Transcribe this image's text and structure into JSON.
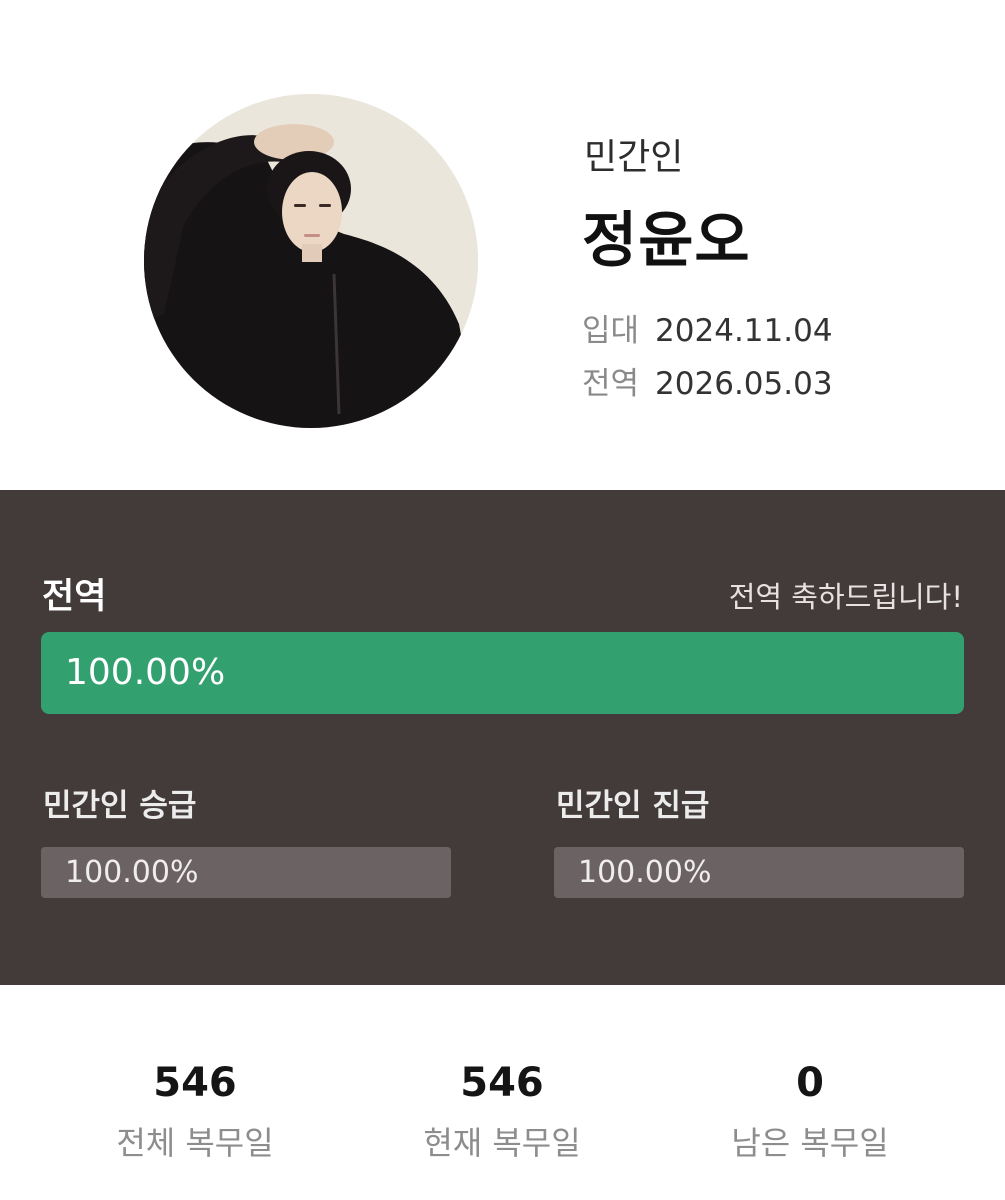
{
  "profile": {
    "rank": "민간인",
    "name": "정윤오",
    "enlist": {
      "label": "입대",
      "date": "2024.11.04"
    },
    "discharge": {
      "label": "전역",
      "date": "2026.05.03"
    }
  },
  "progress": {
    "main": {
      "title": "전역",
      "message": "전역 축하드립니다!",
      "percent_text": "100.00%",
      "fraction": 1.0
    },
    "promotion": {
      "label": "민간인 승급",
      "percent_text": "100.00%",
      "fraction": 1.0
    },
    "advancement": {
      "label": "민간인 진급",
      "percent_text": "100.00%",
      "fraction": 1.0
    }
  },
  "stats": [
    {
      "value": "546",
      "label": "전체 복무일"
    },
    {
      "value": "546",
      "label": "현재 복무일"
    },
    {
      "value": "0",
      "label": "남은 복무일"
    }
  ],
  "colors": {
    "panel_bg": "#433a3a",
    "main_fill": "#33a070",
    "sub_fill": "#6b6363"
  }
}
